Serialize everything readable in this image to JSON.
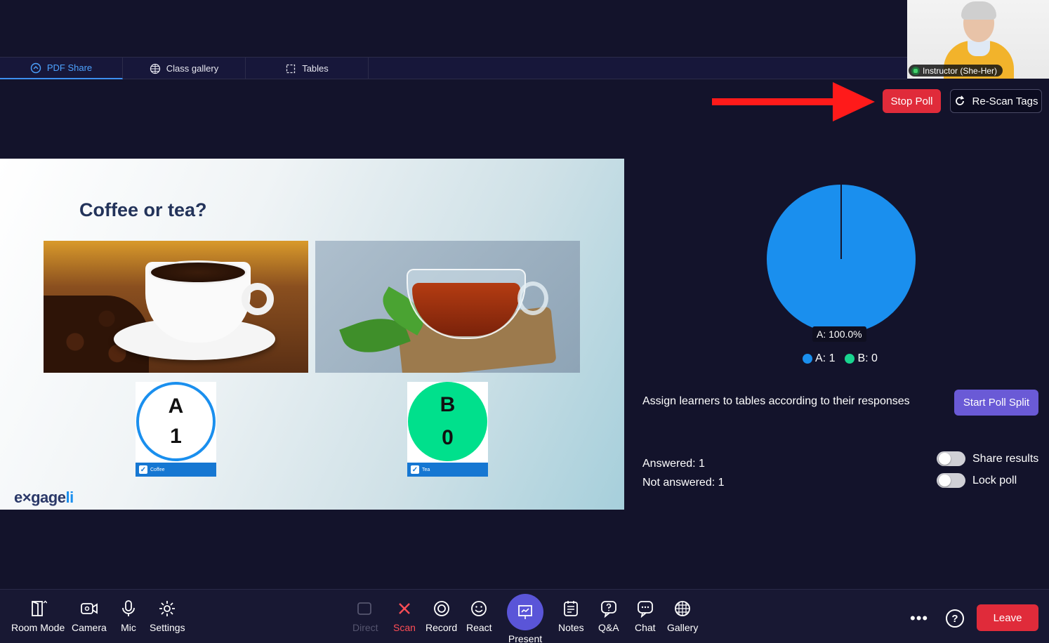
{
  "tabs": [
    {
      "label": "PDF Share",
      "icon": "share-icon",
      "active": true
    },
    {
      "label": "Class gallery",
      "icon": "grid-globe-icon",
      "active": false
    },
    {
      "label": "Tables",
      "icon": "tables-icon",
      "active": false
    }
  ],
  "video": {
    "name": "Instructor (She-Her)"
  },
  "actions": {
    "stop_poll": "Stop Poll",
    "rescan": "Re-Scan Tags"
  },
  "slide": {
    "title": "Coffee or tea?",
    "options": [
      {
        "letter": "A",
        "count": "1",
        "label": "Coffee"
      },
      {
        "letter": "B",
        "count": "0",
        "label": "Tea"
      }
    ],
    "logo_prefix": "e",
    "logo_main": "gage",
    "logo_suffix": "li"
  },
  "chart_data": {
    "type": "pie",
    "slices": [
      {
        "label": "A",
        "value": 1,
        "color": "#1a8fee"
      },
      {
        "label": "B",
        "value": 0,
        "color": "#19d48f"
      }
    ],
    "slice_label": "A: 100.0%",
    "legend": [
      "A: 1",
      "B: 0"
    ]
  },
  "poll": {
    "assign_text": "Assign learners to tables according to their responses",
    "split_button": "Start Poll Split",
    "answered": "Answered: 1",
    "not_answered": "Not answered: 1",
    "share_results": "Share results",
    "lock_poll": "Lock poll"
  },
  "toolbar": {
    "room_mode": "Room Mode",
    "camera": "Camera",
    "mic": "Mic",
    "settings": "Settings",
    "direct": "Direct",
    "scan": "Scan",
    "record": "Record",
    "react": "React",
    "present": "Present",
    "notes": "Notes",
    "qa": "Q&A",
    "chat": "Chat",
    "gallery": "Gallery",
    "more": "•••",
    "help": "?",
    "leave": "Leave"
  },
  "colors": {
    "accent": "#3d8ff0",
    "danger": "#e02b3a",
    "purple": "#6a5ad6",
    "arrow": "#ff1a1a"
  }
}
